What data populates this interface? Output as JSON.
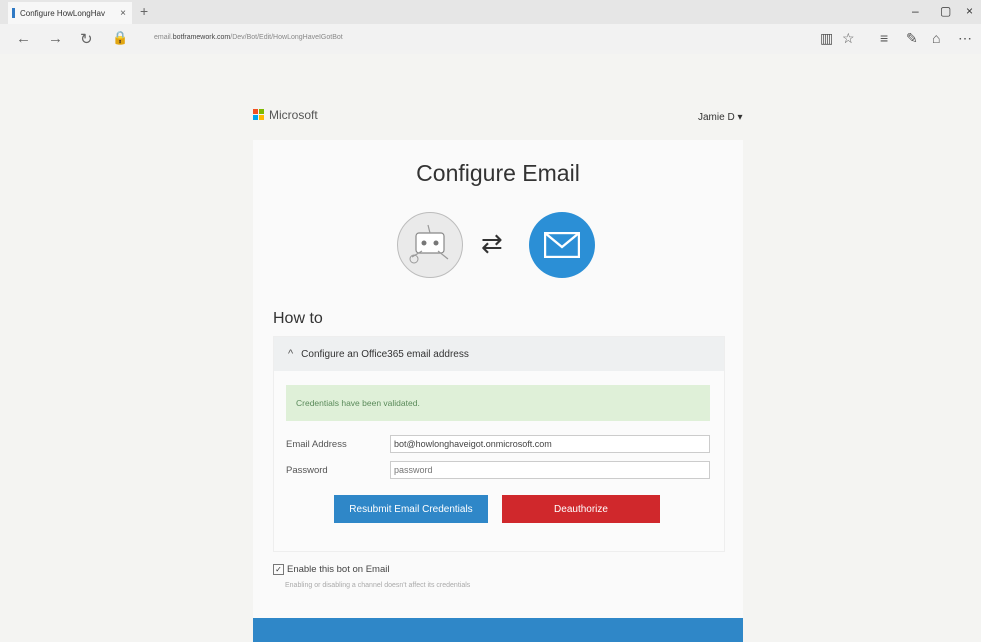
{
  "browser": {
    "tab_title": "Configure HowLongHav",
    "tab_close": "×",
    "new_tab": "+",
    "url_prefix": "email.",
    "url_host": "botframework.com",
    "url_path": "/Dev/Bot/Edit/HowLongHaveIGotBot",
    "window_controls": [
      "–",
      "▢",
      "×"
    ]
  },
  "header": {
    "brand": "Microsoft",
    "brand_colors": [
      "#f25022",
      "#7fba00",
      "#00a4ef",
      "#ffb900"
    ],
    "user_menu": "Jamie D ▾"
  },
  "page": {
    "title": "Configure Email",
    "swap_icon": "⇄",
    "howto": "How to",
    "accent": "#2b8fd6"
  },
  "panel": {
    "header_chevron": "^",
    "header_text": "Configure an Office365 email address",
    "alert": "Credentials have been validated.",
    "email_label": "Email Address",
    "email_value": "bot@howlonghaveigot.onmicrosoft.com",
    "password_label": "Password",
    "password_placeholder": "password",
    "resubmit_label": "Resubmit Email Credentials",
    "deauthorize_label": "Deauthorize"
  },
  "enable": {
    "checked_glyph": "✓",
    "label": "Enable this bot on Email",
    "hint": "Enabling or disabling a channel doesn't affect its credentials"
  }
}
